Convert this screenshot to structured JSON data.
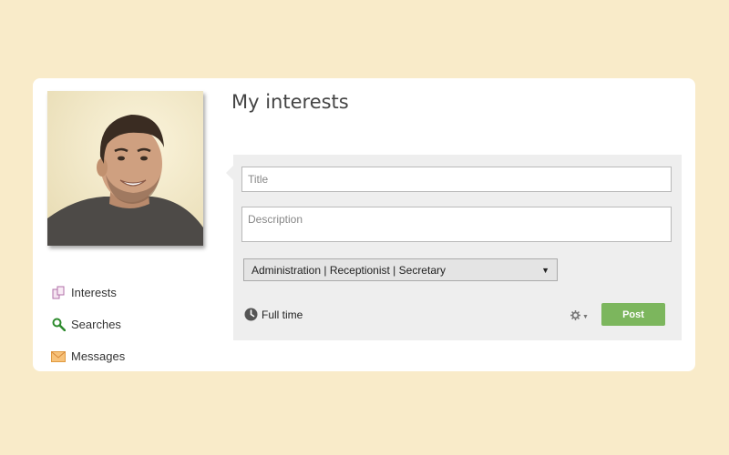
{
  "page": {
    "title": "My interests"
  },
  "sidebar": {
    "items": [
      {
        "label": "Interests",
        "icon": "interests-icon"
      },
      {
        "label": "Searches",
        "icon": "search-icon"
      },
      {
        "label": "Messages",
        "icon": "envelope-icon"
      }
    ]
  },
  "form": {
    "title_placeholder": "Title",
    "description_placeholder": "Description",
    "category_selected": "Administration | Receptionist | Secretary",
    "employment_type": "Full time",
    "employment_icon": "clock-icon",
    "settings_icon": "gear-icon",
    "post_label": "Post"
  },
  "colors": {
    "background": "#f9ebc9",
    "card": "#ffffff",
    "panel": "#eeeeee",
    "post_button": "#7cb65d"
  }
}
